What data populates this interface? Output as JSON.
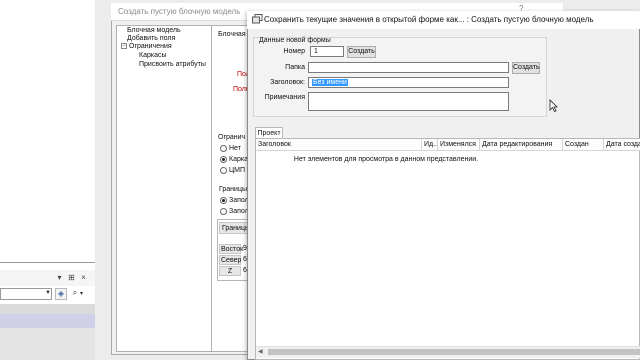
{
  "back_dialog": {
    "title": "Создать пустую блочную модель",
    "help": "?",
    "tree": [
      "Блочная модель",
      "Добавить поля",
      "Ограничения",
      "Каркасы",
      "Присвоить атрибуты"
    ],
    "tree_toggle": "−",
    "panel_label": "Блочная м",
    "red_label_1": "Пол",
    "red_label_2": "Полг",
    "restrictions_label": "Огранич",
    "radio_none": "Нет",
    "radio_wireframes": "Карка",
    "radio_dtm": "ЦМП",
    "bounds_label": "Границы",
    "radio_fill_1": "Запол",
    "radio_fill_2": "Запол",
    "table_header": "Границь",
    "rows": [
      "Восток",
      "Север",
      "Z"
    ],
    "row_values": [
      "9",
      "6",
      "6"
    ]
  },
  "front_dialog": {
    "title": "Сохранить текущие значения в открытой форме как... : Создать пустую блочную модель",
    "group_title": "Данные новой формы",
    "number_label": "Номер",
    "number_value": "1",
    "create_number_btn": "Создать",
    "folder_label": "Папка",
    "folder_value": "",
    "create_folder_btn": "Создать",
    "heading_label": "Заголовок:",
    "heading_value": "Без имени",
    "notes_label": "Примечания",
    "notes_value": "",
    "tab_project": "Проект",
    "columns": [
      "Заголовок",
      "Ид...",
      "Изменялся",
      "Дата редактирования",
      "Создан",
      "Дата создан"
    ],
    "empty_message": "Нет элементов для просмотра в данном представлении."
  },
  "background_app": {
    "pin_icon": "pin-icon",
    "close_icon": "close-icon",
    "tool_icon": "layers-icon",
    "search_icon": "search-icon"
  },
  "colors": {
    "selection": "#3399ff",
    "warning_red": "#c00000"
  }
}
